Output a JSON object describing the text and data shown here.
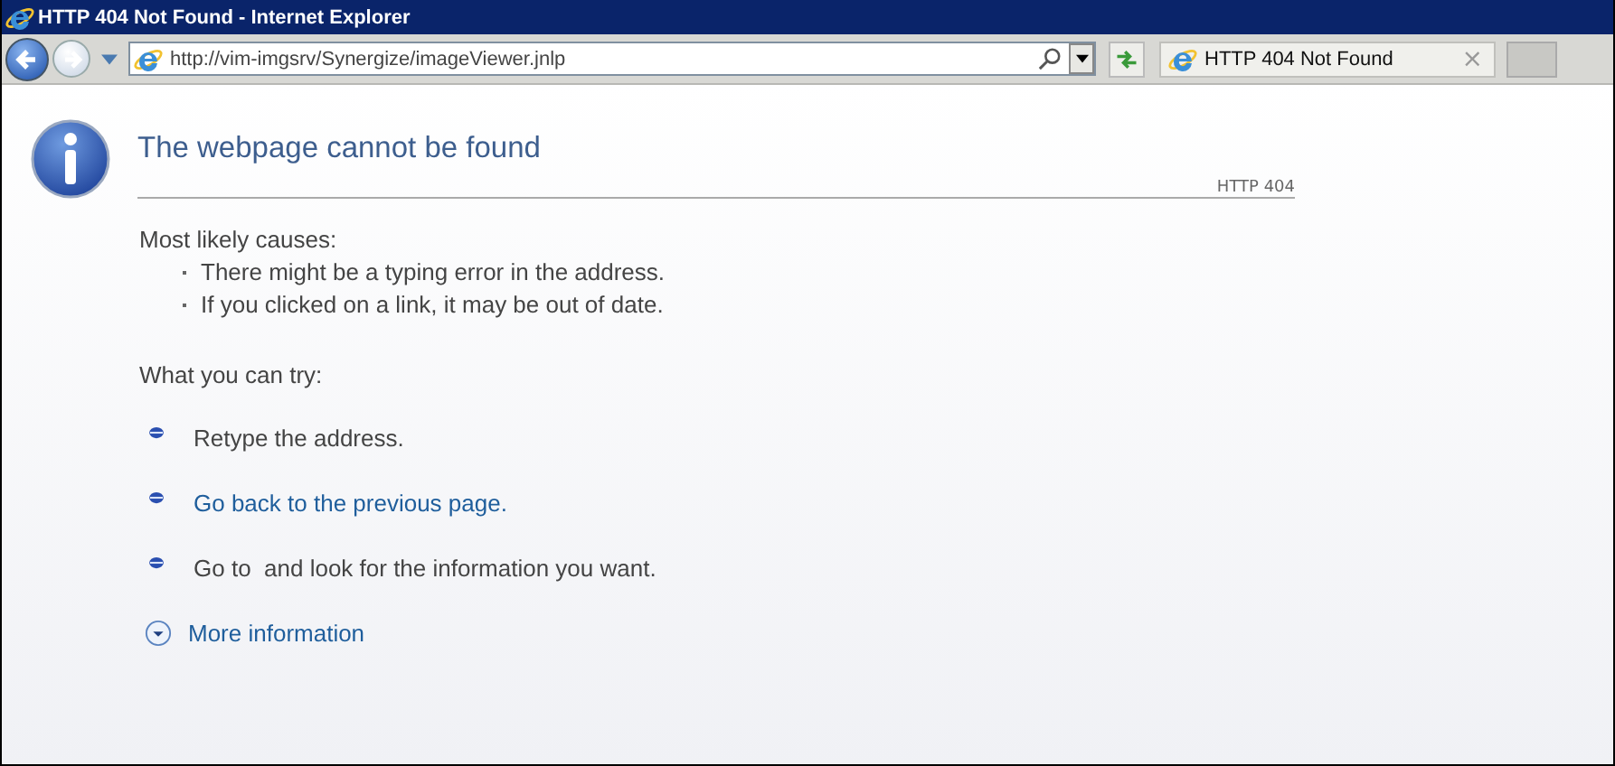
{
  "window": {
    "title": "HTTP 404 Not Found - Internet Explorer"
  },
  "address_bar": {
    "value": "http://vim-imgsrv/Synergize/imageViewer.jnlp"
  },
  "tabs": [
    {
      "label": "HTTP 404 Not Found",
      "selected": true,
      "close": "×"
    }
  ],
  "page": {
    "heading": "The webpage cannot be found",
    "code": "HTTP 404",
    "causes_title": "Most likely causes:",
    "causes": [
      "There might be a typing error in the address.",
      "If you clicked on a link, it may be out of date."
    ],
    "try_title": "What you can try:",
    "tries": [
      {
        "kind": "text",
        "text": "Retype the address."
      },
      {
        "kind": "link",
        "text": "Go back to the previous page."
      },
      {
        "kind": "text",
        "text": "Go to  and look for the information you want."
      }
    ],
    "more": "More information"
  }
}
